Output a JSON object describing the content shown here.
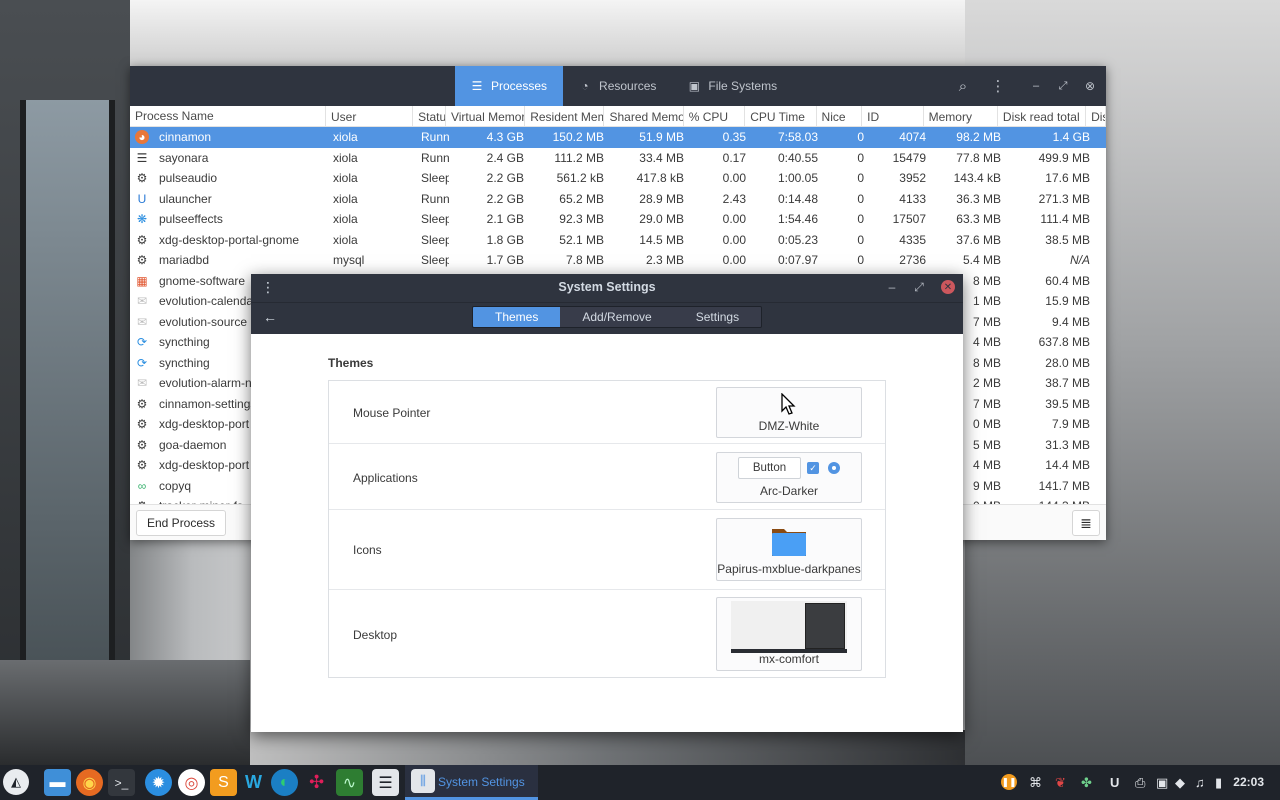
{
  "process_monitor": {
    "tabs": [
      {
        "label": "Processes",
        "icon": "list-icon",
        "active": true
      },
      {
        "label": "Resources",
        "icon": "gauge-icon",
        "active": false
      },
      {
        "label": "File Systems",
        "icon": "disk-icon",
        "active": false
      }
    ],
    "columns": [
      "Process Name",
      "User",
      "Statu",
      "Virtual Memor",
      "Resident Mem",
      "Shared Memor",
      "% CPU",
      "CPU Time",
      "Nice",
      "ID",
      "Memory",
      "Disk read total",
      "Disk"
    ],
    "rows": [
      {
        "name": "cinnamon",
        "user": "xiola",
        "status": "Runni",
        "virt": "4.3 GB",
        "res": "150.2 MB",
        "shr": "51.9 MB",
        "cpu": "0.35",
        "time": "7:58.03",
        "nice": "0",
        "id": "4074",
        "mem": "98.2 MB",
        "disk": "1.4 GB",
        "icon": "cinnamon-icon",
        "color": "#e8773a",
        "selected": true
      },
      {
        "name": "sayonara",
        "user": "xiola",
        "status": "Runni",
        "virt": "2.4 GB",
        "res": "111.2 MB",
        "shr": "33.4 MB",
        "cpu": "0.17",
        "time": "0:40.55",
        "nice": "0",
        "id": "15479",
        "mem": "77.8 MB",
        "disk": "499.9 MB",
        "icon": "list-app-icon",
        "color": "#3a3a3a"
      },
      {
        "name": "pulseaudio",
        "user": "xiola",
        "status": "Sleep",
        "virt": "2.2 GB",
        "res": "561.2 kB",
        "shr": "417.8 kB",
        "cpu": "0.00",
        "time": "1:00.05",
        "nice": "0",
        "id": "3952",
        "mem": "143.4 kB",
        "disk": "17.6 MB",
        "icon": "gear-icon",
        "color": "#3a3a3a"
      },
      {
        "name": "ulauncher",
        "user": "xiola",
        "status": "Runni",
        "virt": "2.2 GB",
        "res": "65.2 MB",
        "shr": "28.9 MB",
        "cpu": "2.43",
        "time": "0:14.48",
        "nice": "0",
        "id": "4133",
        "mem": "36.3 MB",
        "disk": "271.3 MB",
        "icon": "ulauncher-icon",
        "color": "#2b7bd6"
      },
      {
        "name": "pulseeffects",
        "user": "xiola",
        "status": "Sleep",
        "virt": "2.1 GB",
        "res": "92.3 MB",
        "shr": "29.0 MB",
        "cpu": "0.00",
        "time": "1:54.46",
        "nice": "0",
        "id": "17507",
        "mem": "63.3 MB",
        "disk": "111.4 MB",
        "icon": "pulseeffects-icon",
        "color": "#2b8ee0"
      },
      {
        "name": "xdg-desktop-portal-gnome",
        "user": "xiola",
        "status": "Sleep",
        "virt": "1.8 GB",
        "res": "52.1 MB",
        "shr": "14.5 MB",
        "cpu": "0.00",
        "time": "0:05.23",
        "nice": "0",
        "id": "4335",
        "mem": "37.6 MB",
        "disk": "38.5 MB",
        "icon": "gear-icon",
        "color": "#3a3a3a"
      },
      {
        "name": "mariadbd",
        "user": "mysql",
        "status": "Sleep",
        "virt": "1.7 GB",
        "res": "7.8 MB",
        "shr": "2.3 MB",
        "cpu": "0.00",
        "time": "0:07.97",
        "nice": "0",
        "id": "2736",
        "mem": "5.4 MB",
        "disk": "N/A",
        "icon": "gear-icon",
        "color": "#3a3a3a"
      },
      {
        "name": "gnome-software",
        "user": "",
        "status": "",
        "virt": "",
        "res": "",
        "shr": "",
        "cpu": "",
        "time": "",
        "nice": "",
        "id": "",
        "mem": "8 MB",
        "disk": "60.4 MB",
        "icon": "software-icon",
        "color": "#e0552f"
      },
      {
        "name": "evolution-calendar",
        "user": "",
        "status": "",
        "virt": "",
        "res": "",
        "shr": "",
        "cpu": "",
        "time": "",
        "nice": "",
        "id": "",
        "mem": "1 MB",
        "disk": "15.9 MB",
        "icon": "envelope-icon",
        "color": "#bdbdbd"
      },
      {
        "name": "evolution-source",
        "user": "",
        "status": "",
        "virt": "",
        "res": "",
        "shr": "",
        "cpu": "",
        "time": "",
        "nice": "",
        "id": "",
        "mem": "7 MB",
        "disk": "9.4 MB",
        "icon": "envelope-icon",
        "color": "#bdbdbd"
      },
      {
        "name": "syncthing",
        "user": "",
        "status": "",
        "virt": "",
        "res": "",
        "shr": "",
        "cpu": "",
        "time": "",
        "nice": "",
        "id": "",
        "mem": "4 MB",
        "disk": "637.8 MB",
        "icon": "syncthing-icon",
        "color": "#2b8ee0"
      },
      {
        "name": "syncthing",
        "user": "",
        "status": "",
        "virt": "",
        "res": "",
        "shr": "",
        "cpu": "",
        "time": "",
        "nice": "",
        "id": "",
        "mem": "8 MB",
        "disk": "28.0 MB",
        "icon": "syncthing-icon",
        "color": "#2b8ee0"
      },
      {
        "name": "evolution-alarm-n",
        "user": "",
        "status": "",
        "virt": "",
        "res": "",
        "shr": "",
        "cpu": "",
        "time": "",
        "nice": "",
        "id": "",
        "mem": "2 MB",
        "disk": "38.7 MB",
        "icon": "envelope-icon",
        "color": "#bdbdbd"
      },
      {
        "name": "cinnamon-settings",
        "user": "",
        "status": "",
        "virt": "",
        "res": "",
        "shr": "",
        "cpu": "",
        "time": "",
        "nice": "",
        "id": "",
        "mem": "7 MB",
        "disk": "39.5 MB",
        "icon": "gear-icon",
        "color": "#3a3a3a"
      },
      {
        "name": "xdg-desktop-port",
        "user": "",
        "status": "",
        "virt": "",
        "res": "",
        "shr": "",
        "cpu": "",
        "time": "",
        "nice": "",
        "id": "",
        "mem": "0 MB",
        "disk": "7.9 MB",
        "icon": "gear-icon",
        "color": "#3a3a3a"
      },
      {
        "name": "goa-daemon",
        "user": "",
        "status": "",
        "virt": "",
        "res": "",
        "shr": "",
        "cpu": "",
        "time": "",
        "nice": "",
        "id": "",
        "mem": "5 MB",
        "disk": "31.3 MB",
        "icon": "gear-icon",
        "color": "#3a3a3a"
      },
      {
        "name": "xdg-desktop-port",
        "user": "",
        "status": "",
        "virt": "",
        "res": "",
        "shr": "",
        "cpu": "",
        "time": "",
        "nice": "",
        "id": "",
        "mem": "4 MB",
        "disk": "14.4 MB",
        "icon": "gear-icon",
        "color": "#3a3a3a"
      },
      {
        "name": "copyq",
        "user": "",
        "status": "",
        "virt": "",
        "res": "",
        "shr": "",
        "cpu": "",
        "time": "",
        "nice": "",
        "id": "",
        "mem": "9 MB",
        "disk": "141.7 MB",
        "icon": "copyq-icon",
        "color": "#3cb371"
      },
      {
        "name": "tracker-miner-fs",
        "user": "",
        "status": "",
        "virt": "",
        "res": "",
        "shr": "",
        "cpu": "",
        "time": "",
        "nice": "",
        "id": "",
        "mem": "0 MB",
        "disk": "144.3 MB",
        "icon": "gear-icon",
        "color": "#3a3a3a"
      }
    ],
    "footer": {
      "end_process": "End Process"
    }
  },
  "settings": {
    "title": "System Settings",
    "stack": [
      "Themes",
      "Add/Remove",
      "Settings"
    ],
    "section": "Themes",
    "rows": [
      {
        "label": "Mouse Pointer",
        "value": "DMZ-White"
      },
      {
        "label": "Applications",
        "value": "Arc-Darker",
        "preview_button": "Button"
      },
      {
        "label": "Icons",
        "value": "Papirus-mxblue-darkpanes"
      },
      {
        "label": "Desktop",
        "value": "mx-comfort"
      }
    ]
  },
  "taskbar": {
    "active_window": "System Settings",
    "clock": "22:03",
    "accent": "#5294e2"
  }
}
